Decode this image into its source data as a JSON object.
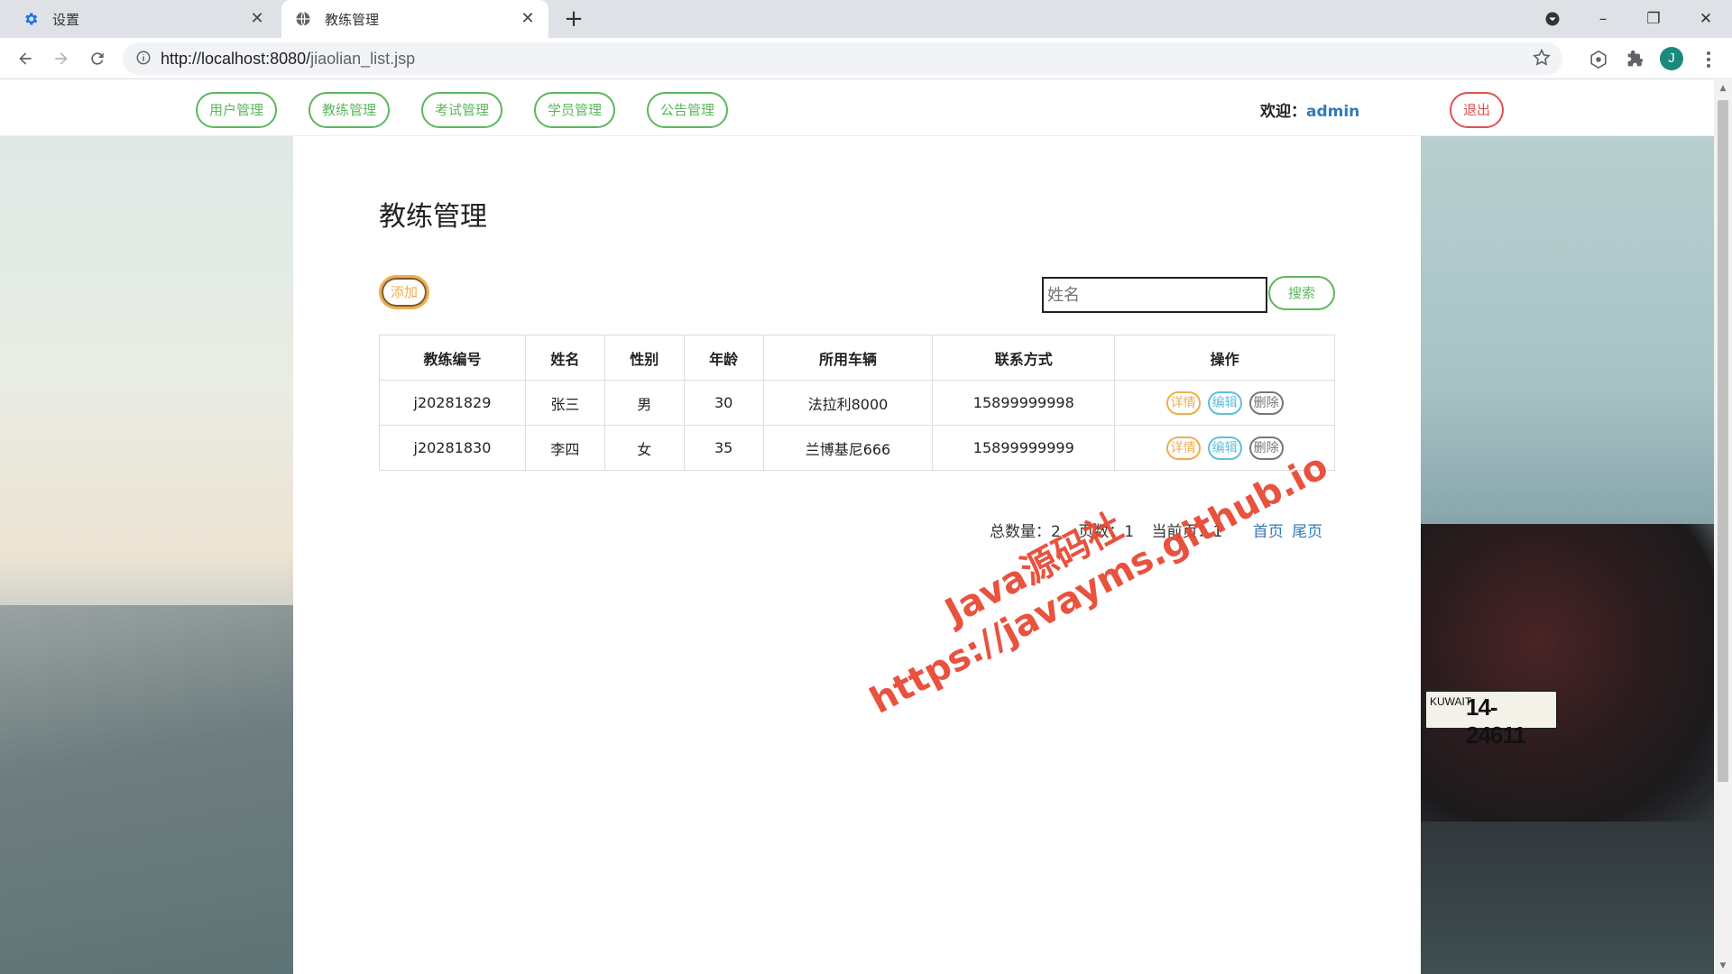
{
  "browser": {
    "tabs": [
      {
        "title": "设置",
        "icon": "gear-icon"
      },
      {
        "title": "教练管理",
        "icon": "globe-icon"
      }
    ],
    "url_host": "http://localhost:8080/",
    "url_path": "jiaolian_list.jsp",
    "avatar_letter": "J"
  },
  "nav": {
    "items": [
      "用户管理",
      "教练管理",
      "考试管理",
      "学员管理",
      "公告管理"
    ],
    "welcome_label": "欢迎：",
    "username": "admin",
    "logout": "退出"
  },
  "page": {
    "title": "教练管理",
    "add_button": "添加",
    "search_placeholder": "姓名",
    "search_button": "搜索"
  },
  "table": {
    "headers": [
      "教练编号",
      "姓名",
      "性别",
      "年龄",
      "所用车辆",
      "联系方式",
      "操作"
    ],
    "rows": [
      {
        "id": "j20281829",
        "name": "张三",
        "gender": "男",
        "age": "30",
        "car": "法拉利8000",
        "phone": "15899999998"
      },
      {
        "id": "j20281830",
        "name": "李四",
        "gender": "女",
        "age": "35",
        "car": "兰博基尼666",
        "phone": "15899999999"
      }
    ],
    "actions": {
      "detail": "详情",
      "edit": "编辑",
      "delete": "删除"
    }
  },
  "pager": {
    "total": "总数量：2",
    "pages": "页数：1",
    "current": "当前页：1",
    "first": "首页",
    "last": "尾页"
  },
  "watermark": {
    "line1": "Java源码社",
    "line2": "https://javayms.github.io"
  },
  "background": {
    "plate_country": "KUWAIT",
    "plate_number": "14-24611"
  },
  "colors": {
    "success": "#5cb85c",
    "warning": "#f0ad4e",
    "info": "#5bc0de",
    "danger": "#d9534f",
    "link": "#337ab7",
    "watermark": "#e8442f"
  }
}
